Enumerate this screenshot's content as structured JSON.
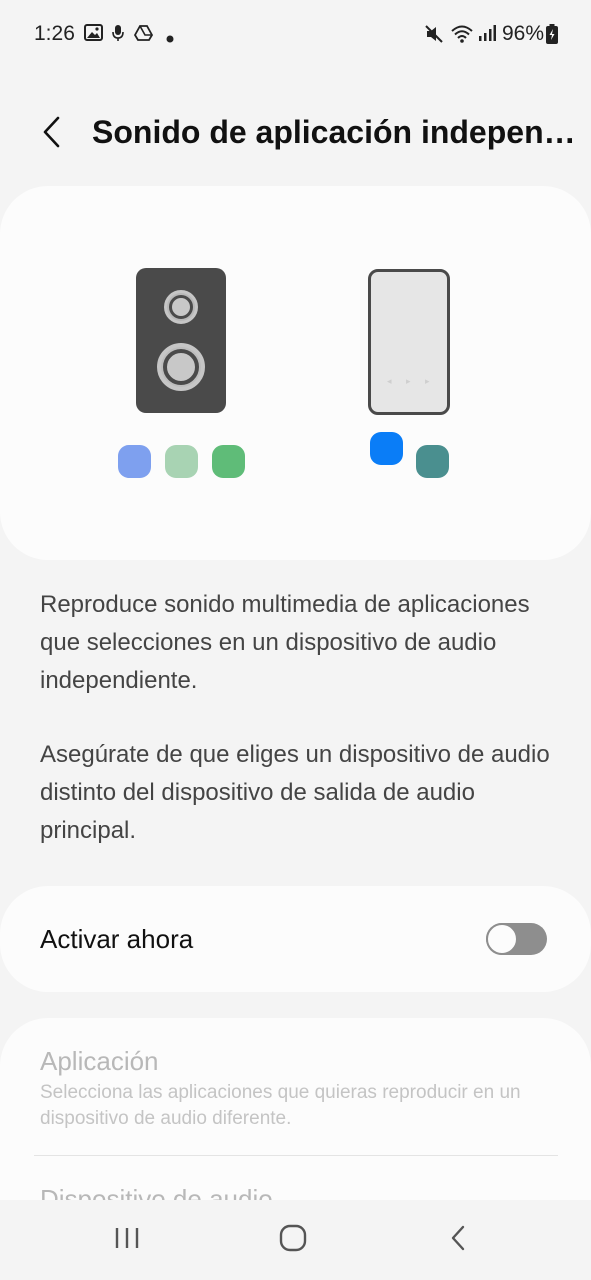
{
  "status_bar": {
    "time": "1:26",
    "battery": "96%",
    "icons": [
      "image-icon",
      "microphone-icon",
      "drive-icon",
      "dot-icon",
      "mute-icon",
      "wifi-icon",
      "signal-icon",
      "battery-icon"
    ]
  },
  "header": {
    "title": "Sonido de aplicación independ…",
    "back_icon": "chevron-left-icon"
  },
  "illustration": {
    "speaker_dot_colors": [
      "#7ea0ef",
      "#a8d3b3",
      "#5fbc78"
    ],
    "phone_dot_colors": [
      "#0a7df7",
      "#4a8f8f"
    ],
    "phone_controls": "◂ ▸ ▸"
  },
  "description": {
    "paragraph1": "Reproduce sonido multimedia de aplicaciones que selecciones en un dispositivo de audio independiente.",
    "paragraph2": "Asegúrate de que eliges un dispositivo de audio distinto del dispositivo de salida de audio principal."
  },
  "toggle": {
    "label": "Activar ahora",
    "enabled": false
  },
  "settings": {
    "app_title": "Aplicación",
    "app_subtitle": "Selecciona las aplicaciones que quieras reproducir en un dispositivo de audio diferente.",
    "device_title": "Dispositivo de audio"
  },
  "nav": {
    "recents_icon": "recents-icon",
    "home_icon": "home-icon",
    "back_icon": "back-icon"
  },
  "colors": {
    "background": "#f4f4f4",
    "card": "#fcfcfc",
    "disabled_text": "#b8b8b8"
  }
}
